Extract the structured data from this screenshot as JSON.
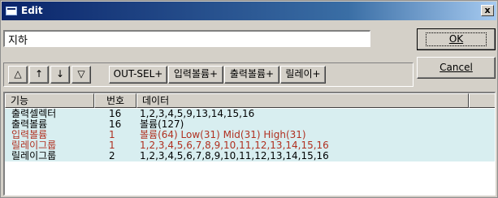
{
  "window": {
    "title": "Edit",
    "close_label": "x"
  },
  "name_field": {
    "value": "지하"
  },
  "buttons": {
    "ok": "OK",
    "cancel": "Cancel"
  },
  "toolbar": {
    "move_top": "△",
    "move_up": "↑",
    "move_down": "↓",
    "move_bottom": "▽",
    "out_sel": "OUT-SEL+",
    "input_volume": "입력볼륨+",
    "output_volume": "출력볼륨+",
    "relay": "릴레이+"
  },
  "table": {
    "headers": [
      "기능",
      "번호",
      "데이터",
      ""
    ],
    "rows": [
      {
        "name": "출력셀렉터",
        "num": "16",
        "data": "1,2,3,4,5,9,13,14,15,16",
        "shaded": true,
        "highlight": false
      },
      {
        "name": "출력볼륨",
        "num": "16",
        "data": "볼륨(127)",
        "shaded": true,
        "highlight": false
      },
      {
        "name": "입력볼륨",
        "num": "1",
        "data": "볼륨(64) Low(31) Mid(31) High(31)",
        "shaded": true,
        "highlight": true
      },
      {
        "name": "릴레이그룹",
        "num": "1",
        "data": "1,2,3,4,5,6,7,8,9,10,11,12,13,14,15,16",
        "shaded": true,
        "highlight": true
      },
      {
        "name": "릴레이그룹",
        "num": "2",
        "data": "1,2,3,4,5,6,7,8,9,10,11,12,13,14,15,16",
        "shaded": true,
        "highlight": false
      }
    ]
  },
  "colors": {
    "title_bar": "#0a246a",
    "row_shade": "#d8eef0",
    "highlight_text": "#b03020"
  }
}
